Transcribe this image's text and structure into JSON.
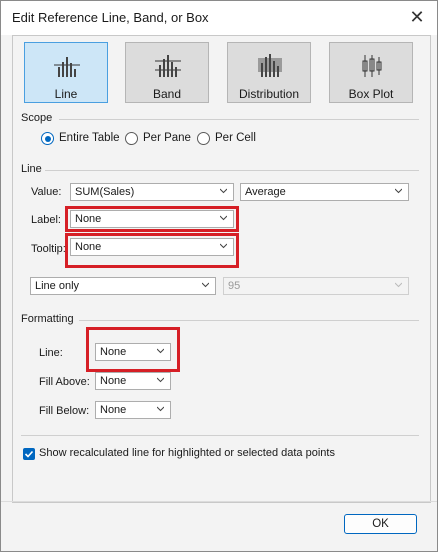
{
  "window": {
    "title": "Edit Reference Line, Band, or Box"
  },
  "types": [
    {
      "label": "Line",
      "icon": "line-chart-icon",
      "selected": true
    },
    {
      "label": "Band",
      "icon": "band-chart-icon",
      "selected": false
    },
    {
      "label": "Distribution",
      "icon": "distribution-chart-icon",
      "selected": false
    },
    {
      "label": "Box Plot",
      "icon": "box-plot-icon",
      "selected": false
    }
  ],
  "scope": {
    "heading": "Scope",
    "options": [
      {
        "label": "Entire Table",
        "checked": true
      },
      {
        "label": "Per Pane",
        "checked": false
      },
      {
        "label": "Per Cell",
        "checked": false
      }
    ]
  },
  "line": {
    "heading": "Line",
    "value_label": "Value:",
    "value_field": "SUM(Sales)",
    "aggregation": "Average",
    "label_label": "Label:",
    "label_value": "None",
    "tooltip_label": "Tooltip:",
    "tooltip_value": "None",
    "line_mode": "Line only",
    "confidence": "95"
  },
  "formatting": {
    "heading": "Formatting",
    "line_label": "Line:",
    "line_value": "None",
    "fill_above_label": "Fill Above:",
    "fill_above_value": "None",
    "fill_below_label": "Fill Below:",
    "fill_below_value": "None"
  },
  "recalc": {
    "label": "Show recalculated line for highlighted or selected data points",
    "checked": true
  },
  "ok_label": "OK",
  "colors": {
    "accent": "#0067c0",
    "highlight": "#d61f26",
    "selected_bg": "#cde6f7"
  }
}
